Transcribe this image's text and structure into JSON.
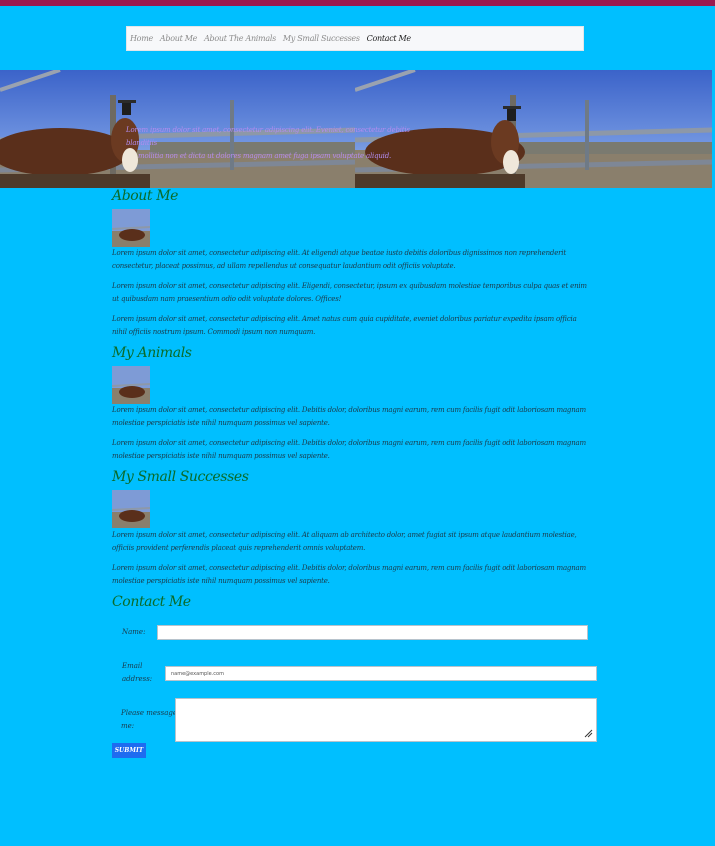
{
  "nav": {
    "items": [
      {
        "label": "Home"
      },
      {
        "label": "About Me"
      },
      {
        "label": "About The Animals"
      },
      {
        "label": "My Small Successes"
      },
      {
        "label": "Contact Me"
      }
    ]
  },
  "hero": {
    "line1": "Lorem ipsum dolor sit amet, consectetur adipiscing elit. Eveniet, consectetur debitis blanditiis",
    "line2": "mollitia non et dicta ut dolores magnam amet fuga ipsam voluptate aliquid."
  },
  "about": {
    "heading": "About Me",
    "paragraphs": [
      "Lorem ipsum dolor sit amet, consectetur adipiscing elit. At eligendi atque beatae iusto debitis doloribus dignissimos non reprehenderit consectetur, placeat possimus, ad ullam repellendus ut consequatur laudantium odit officiis voluptate.",
      "Lorem ipsum dolor sit amet, consectetur adipiscing elit. Eligendi, consectetur, ipsum ex quibusdam molestiae temporibus culpa quas et enim ut quibusdam nam praesentium odio odit voluptate dolores. Offices!",
      "Lorem ipsum dolor sit amet, consectetur adipiscing elit. Amet natus cum quia cupiditate, eveniet doloribus pariatur expedita ipsam officia nihil officiis nostrum ipsum. Commodi ipsum non numquam."
    ]
  },
  "animals": {
    "heading": "My Animals",
    "paragraphs": [
      "Lorem ipsum dolor sit amet, consectetur adipiscing elit. Debitis dolor, doloribus magni earum, rem cum facilis fugit odit laboriosam magnam molestiae perspiciatis iste nihil numquam possimus vel sapiente.",
      "Lorem ipsum dolor sit amet, consectetur adipiscing elit. Debitis dolor, doloribus magni earum, rem cum facilis fugit odit laboriosam magnam molestiae perspiciatis iste nihil numquam possimus vel sapiente."
    ]
  },
  "successes": {
    "heading": "My Small Successes",
    "paragraphs": [
      "Lorem ipsum dolor sit amet, consectetur adipiscing elit. At aliquam ab architecto dolor, amet fugiat sit ipsum atque laudantium molestiae, officiis provident perferendis placeat quis reprehenderit omnis voluptatem.",
      "Lorem ipsum dolor sit amet, consectetur adipiscing elit. Debitis dolor, doloribus magni earum, rem cum facilis fugit odit laboriosam magnam molestiae perspiciatis iste nihil numquam possimus vel sapiente."
    ]
  },
  "contact": {
    "heading": "Contact Me",
    "name_label": "Name:",
    "email_label_1": "Email",
    "email_label_2": "address:",
    "email_placeholder": "name@example.com",
    "message_label_1": "Please message to",
    "message_label_2": "me:",
    "submit_label": "SUBMIT"
  }
}
